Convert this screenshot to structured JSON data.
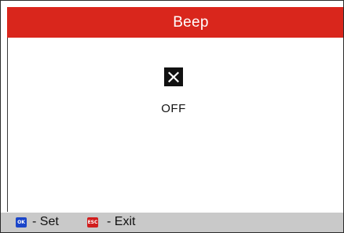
{
  "header": {
    "title": "Beep"
  },
  "setting": {
    "state_icon": "x-box-icon",
    "state_label": "OFF"
  },
  "footer": {
    "ok_key_label": "OK",
    "ok_hint": "- Set",
    "esc_key_label": "ESC",
    "esc_hint": "- Exit"
  },
  "colors": {
    "title_bar": "#d9261c",
    "footer_bar": "#c9c9c9",
    "ok_key": "#1a45c9",
    "esc_key": "#d11d1d"
  }
}
